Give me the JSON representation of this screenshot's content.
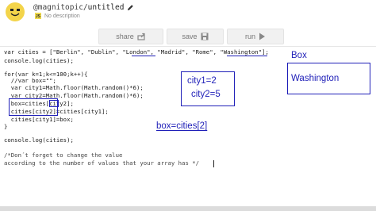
{
  "header": {
    "username": "@magnitopic",
    "project_name": "untitled",
    "description": "No description",
    "language_badge": "JS"
  },
  "toolbar": {
    "share_label": "share",
    "save_label": "save",
    "run_label": "run"
  },
  "code": {
    "lines": [
      "var cities = [\"Berlin\", \"Dublin\", \"London\", \"Madrid\", \"Rome\", \"Washington\"];",
      "console.log(cities);",
      "",
      "for(var k=1;k<=100;k++){",
      "  //var box=\"\";",
      "  var city1=Math.floor(Math.random()*6);",
      "  var city2=Math.floor(Math.random()*6);",
      "  box=cities[city2];",
      "  cities[city2]=cities[city1];",
      "  cities[city1]=box;",
      "}",
      "",
      "console.log(cities);",
      "",
      "/*Don´t forget to change the value",
      "according to the number of values that your array has */"
    ]
  },
  "annotations": {
    "box_title": "Box",
    "washington": "Washington",
    "city1": "city1=2",
    "city2": "city2=5",
    "box_assign": "box=cities[2]"
  },
  "colors": {
    "annotation_ink": "#1f1fb8",
    "button_bg": "#f1f1f1",
    "avatar": "#f3d44a"
  }
}
